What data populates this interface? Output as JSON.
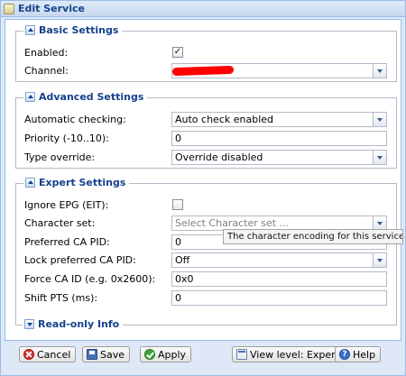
{
  "window": {
    "title": "Edit Service"
  },
  "basic": {
    "legend": "Basic Settings",
    "enabled_label": "Enabled:",
    "enabled_checked": true,
    "channel_label": "Channel:"
  },
  "advanced": {
    "legend": "Advanced Settings",
    "auto_check_label": "Automatic checking:",
    "auto_check_value": "Auto check enabled",
    "priority_label": "Priority (-10..10):",
    "priority_value": "0",
    "type_override_label": "Type override:",
    "type_override_value": "Override disabled"
  },
  "expert": {
    "legend": "Expert Settings",
    "ignore_epg_label": "Ignore EPG (EIT):",
    "ignore_epg_checked": false,
    "charset_label": "Character set:",
    "charset_placeholder": "Select Character set ...",
    "preferred_ca_label": "Preferred CA PID:",
    "preferred_ca_value": "0",
    "lock_ca_label": "Lock preferred CA PID:",
    "lock_ca_value": "Off",
    "force_ca_label": "Force CA ID (e.g. 0x2600):",
    "force_ca_value": "0x0",
    "shift_pts_label": "Shift PTS (ms):",
    "shift_pts_value": "0"
  },
  "tooltip": {
    "text": "The character encoding for this service (e.g. UTF"
  },
  "readonly": {
    "legend": "Read-only Info"
  },
  "toolbar": {
    "cancel_label": "Cancel",
    "save_label": "Save",
    "apply_label": "Apply",
    "view_level_label": "View level: Expert",
    "help_label": "Help"
  },
  "icons": {
    "cancel": "cancel-icon",
    "save": "save-icon",
    "apply": "apply-icon",
    "view_level": "view-level-icon",
    "help": "help-icon"
  }
}
